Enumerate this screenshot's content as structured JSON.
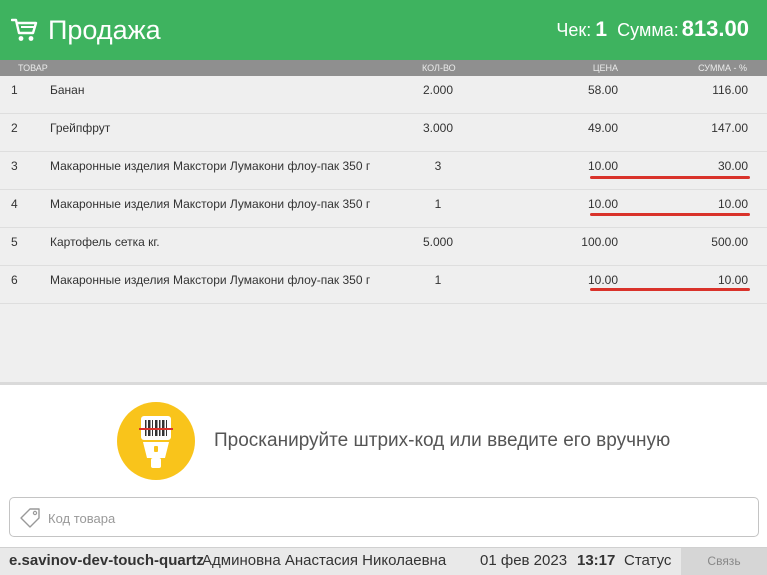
{
  "header": {
    "title": "Продажа",
    "check_label": "Чек:",
    "check_number": "1",
    "sum_label": "Сумма:",
    "sum_value": "813.00",
    "color": "#3eb35f"
  },
  "columns": {
    "name": "ТОВАР",
    "qty": "КОЛ-ВО",
    "price": "ЦЕНА",
    "total": "СУММА - %"
  },
  "items": [
    {
      "num": "1",
      "name": "Банан",
      "qty": "2.000",
      "price": "58.00",
      "total": "116.00",
      "highlighted": false
    },
    {
      "num": "2",
      "name": "Грейпфрут",
      "qty": "3.000",
      "price": "49.00",
      "total": "147.00",
      "highlighted": false
    },
    {
      "num": "3",
      "name": "Макаронные изделия Макстори Лумакони флоу-пак 350 г",
      "qty": "3",
      "price": "10.00",
      "total": "30.00",
      "highlighted": true
    },
    {
      "num": "4",
      "name": "Макаронные изделия Макстори Лумакони флоу-пак 350 г",
      "qty": "1",
      "price": "10.00",
      "total": "10.00",
      "highlighted": true
    },
    {
      "num": "5",
      "name": "Картофель сетка кг.",
      "qty": "5.000",
      "price": "100.00",
      "total": "500.00",
      "highlighted": false
    },
    {
      "num": "6",
      "name": "Макаронные изделия Макстори Лумакони флоу-пак 350 г",
      "qty": "1",
      "price": "10.00",
      "total": "10.00",
      "highlighted": true
    }
  ],
  "scan": {
    "message": "Просканируйте штрих-код или введите его вручную",
    "icon": "barcode-scanner-icon",
    "color": "#f9c41b"
  },
  "code_input": {
    "placeholder": "Код товара",
    "value": "",
    "icon": "tag-icon"
  },
  "status_bar": {
    "host": "e.savinov-dev-touch-quartz",
    "user": "Админовна Анастасия Николаевна",
    "date": "01 фев 2023",
    "time": "13:17",
    "status": "Статус",
    "link_label": "Связь"
  },
  "highlight_color": "#d9322a"
}
